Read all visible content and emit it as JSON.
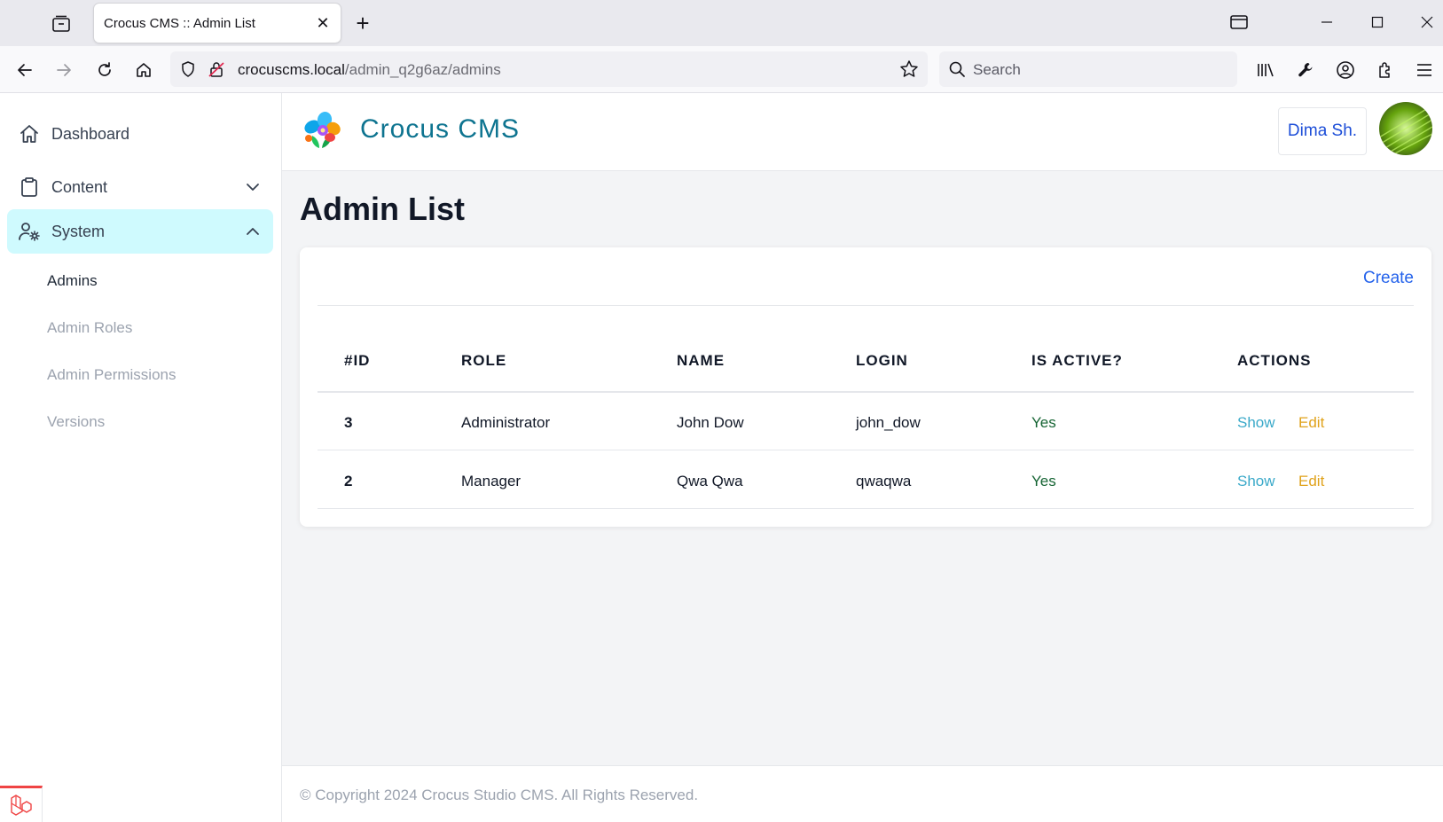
{
  "browser": {
    "tab_title": "Crocus CMS :: Admin List",
    "tab_close": "✕",
    "new_tab": "+",
    "url_host": "crocuscms.local",
    "url_path": "/admin_q2g6az/admins",
    "search_placeholder": "Search"
  },
  "sidebar": {
    "items": [
      {
        "label": "Dashboard",
        "icon": "home-icon"
      },
      {
        "label": "Content",
        "icon": "clipboard-icon",
        "state": "collapsed"
      },
      {
        "label": "System",
        "icon": "user-gear-icon",
        "state": "expanded"
      }
    ],
    "sub_items": [
      {
        "label": "Admins",
        "current": true
      },
      {
        "label": "Admin Roles"
      },
      {
        "label": "Admin Permissions"
      },
      {
        "label": "Versions"
      }
    ]
  },
  "header": {
    "brand": "Crocus CMS",
    "user_name": "Dima Sh."
  },
  "main": {
    "title": "Admin List",
    "create_label": "Create",
    "table": {
      "columns": [
        "#ID",
        "ROLE",
        "NAME",
        "LOGIN",
        "IS ACTIVE?",
        "ACTIONS"
      ],
      "rows": [
        {
          "id": "3",
          "role": "Administrator",
          "name": "John Dow",
          "login": "john_dow",
          "active": "Yes",
          "show": "Show",
          "edit": "Edit"
        },
        {
          "id": "2",
          "role": "Manager",
          "name": "Qwa Qwa",
          "login": "qwaqwa",
          "active": "Yes",
          "show": "Show",
          "edit": "Edit"
        }
      ]
    }
  },
  "footer": {
    "copyright": "© Copyright 2024 Crocus Studio CMS. All Rights Reserved."
  },
  "colors": {
    "accent": "#0e7490",
    "active_nav_bg": "#cffafe",
    "link_blue": "#2563eb",
    "yes_green": "#166534",
    "show_cyan": "#3aa9c9",
    "edit_amber": "#e0a21b"
  }
}
